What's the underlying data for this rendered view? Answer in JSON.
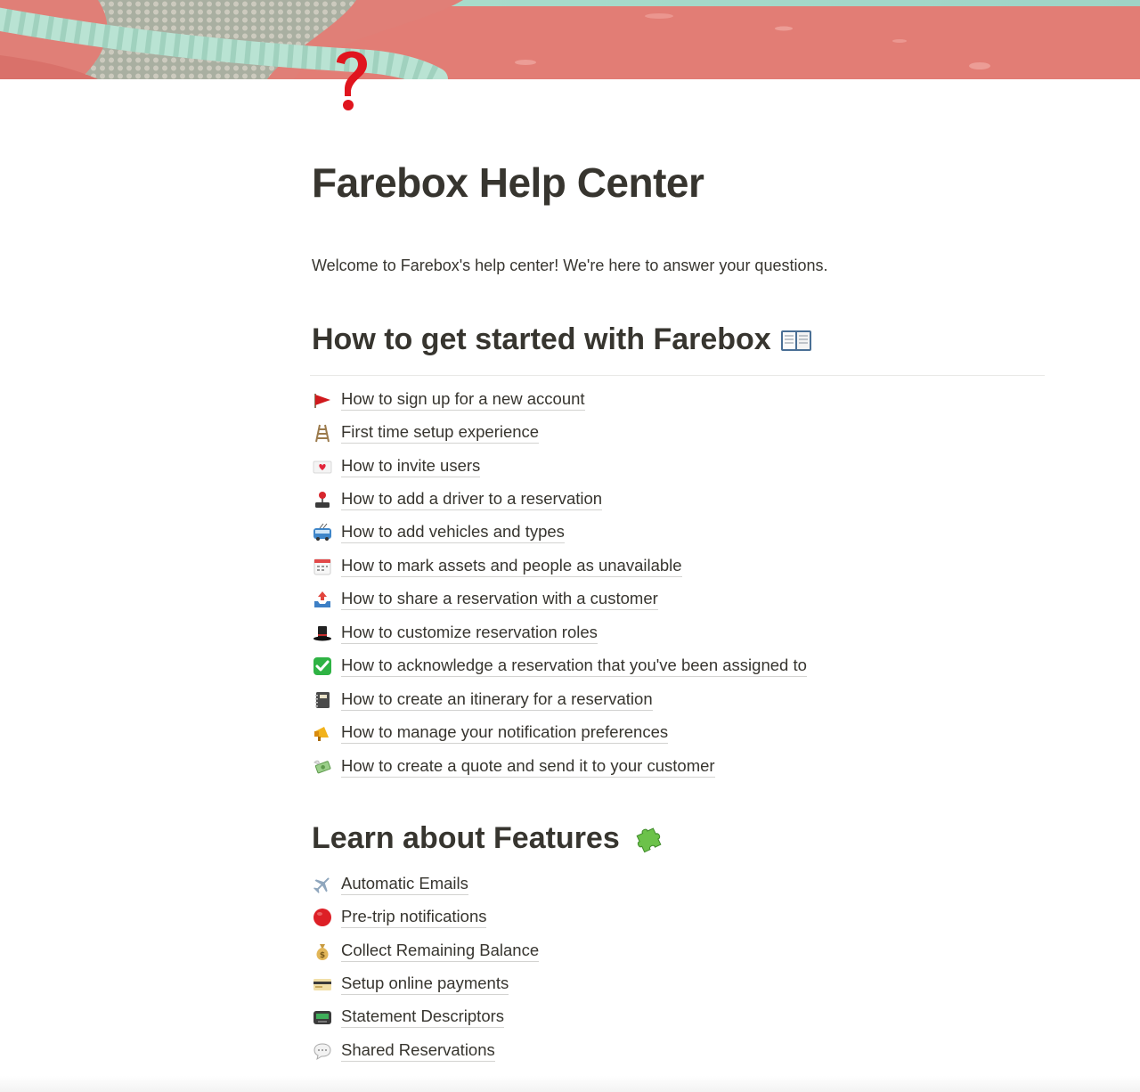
{
  "page": {
    "title": "Farebox Help Center",
    "intro": "Welcome to Farebox's help center! We're here to answer your questions.",
    "page_icon": "question-mark-icon"
  },
  "sections": [
    {
      "heading": "How to get started with Farebox",
      "heading_icon": "open-book-icon",
      "items": [
        {
          "icon": "triangular-flag-icon",
          "label": "How to sign up for a new account"
        },
        {
          "icon": "ladder-icon",
          "label": "First time setup experience"
        },
        {
          "icon": "love-letter-icon",
          "label": "How to invite users"
        },
        {
          "icon": "joystick-icon",
          "label": "How to add a driver to a reservation"
        },
        {
          "icon": "trolleybus-icon",
          "label": "How to add vehicles and types"
        },
        {
          "icon": "calendar-icon",
          "label": "How to mark assets and people as unavailable"
        },
        {
          "icon": "outbox-tray-icon",
          "label": "How to share a reservation with a customer"
        },
        {
          "icon": "top-hat-icon",
          "label": "How to customize reservation roles"
        },
        {
          "icon": "check-mark-icon",
          "label": "How to acknowledge a reservation that you've been assigned to"
        },
        {
          "icon": "notebook-icon",
          "label": "How to create an itinerary for a reservation"
        },
        {
          "icon": "megaphone-icon",
          "label": "How to manage your notification preferences"
        },
        {
          "icon": "money-with-wings-icon",
          "label": "How to create a quote and send it to your customer"
        }
      ]
    },
    {
      "heading": "Learn about Features",
      "heading_icon": "puzzle-piece-icon",
      "items": [
        {
          "icon": "airplane-icon",
          "label": "Automatic Emails"
        },
        {
          "icon": "red-circle-icon",
          "label": "Pre-trip notifications"
        },
        {
          "icon": "money-bag-icon",
          "label": "Collect Remaining Balance"
        },
        {
          "icon": "credit-card-icon",
          "label": "Setup online payments"
        },
        {
          "icon": "pager-icon",
          "label": "Statement Descriptors"
        },
        {
          "icon": "speech-bubble-icon",
          "label": "Shared Reservations"
        }
      ]
    }
  ],
  "colors": {
    "text": "#37352f",
    "cover_red": "#e27b73",
    "cover_mint": "#a8d8c4",
    "icon_red": "#e0151e"
  }
}
